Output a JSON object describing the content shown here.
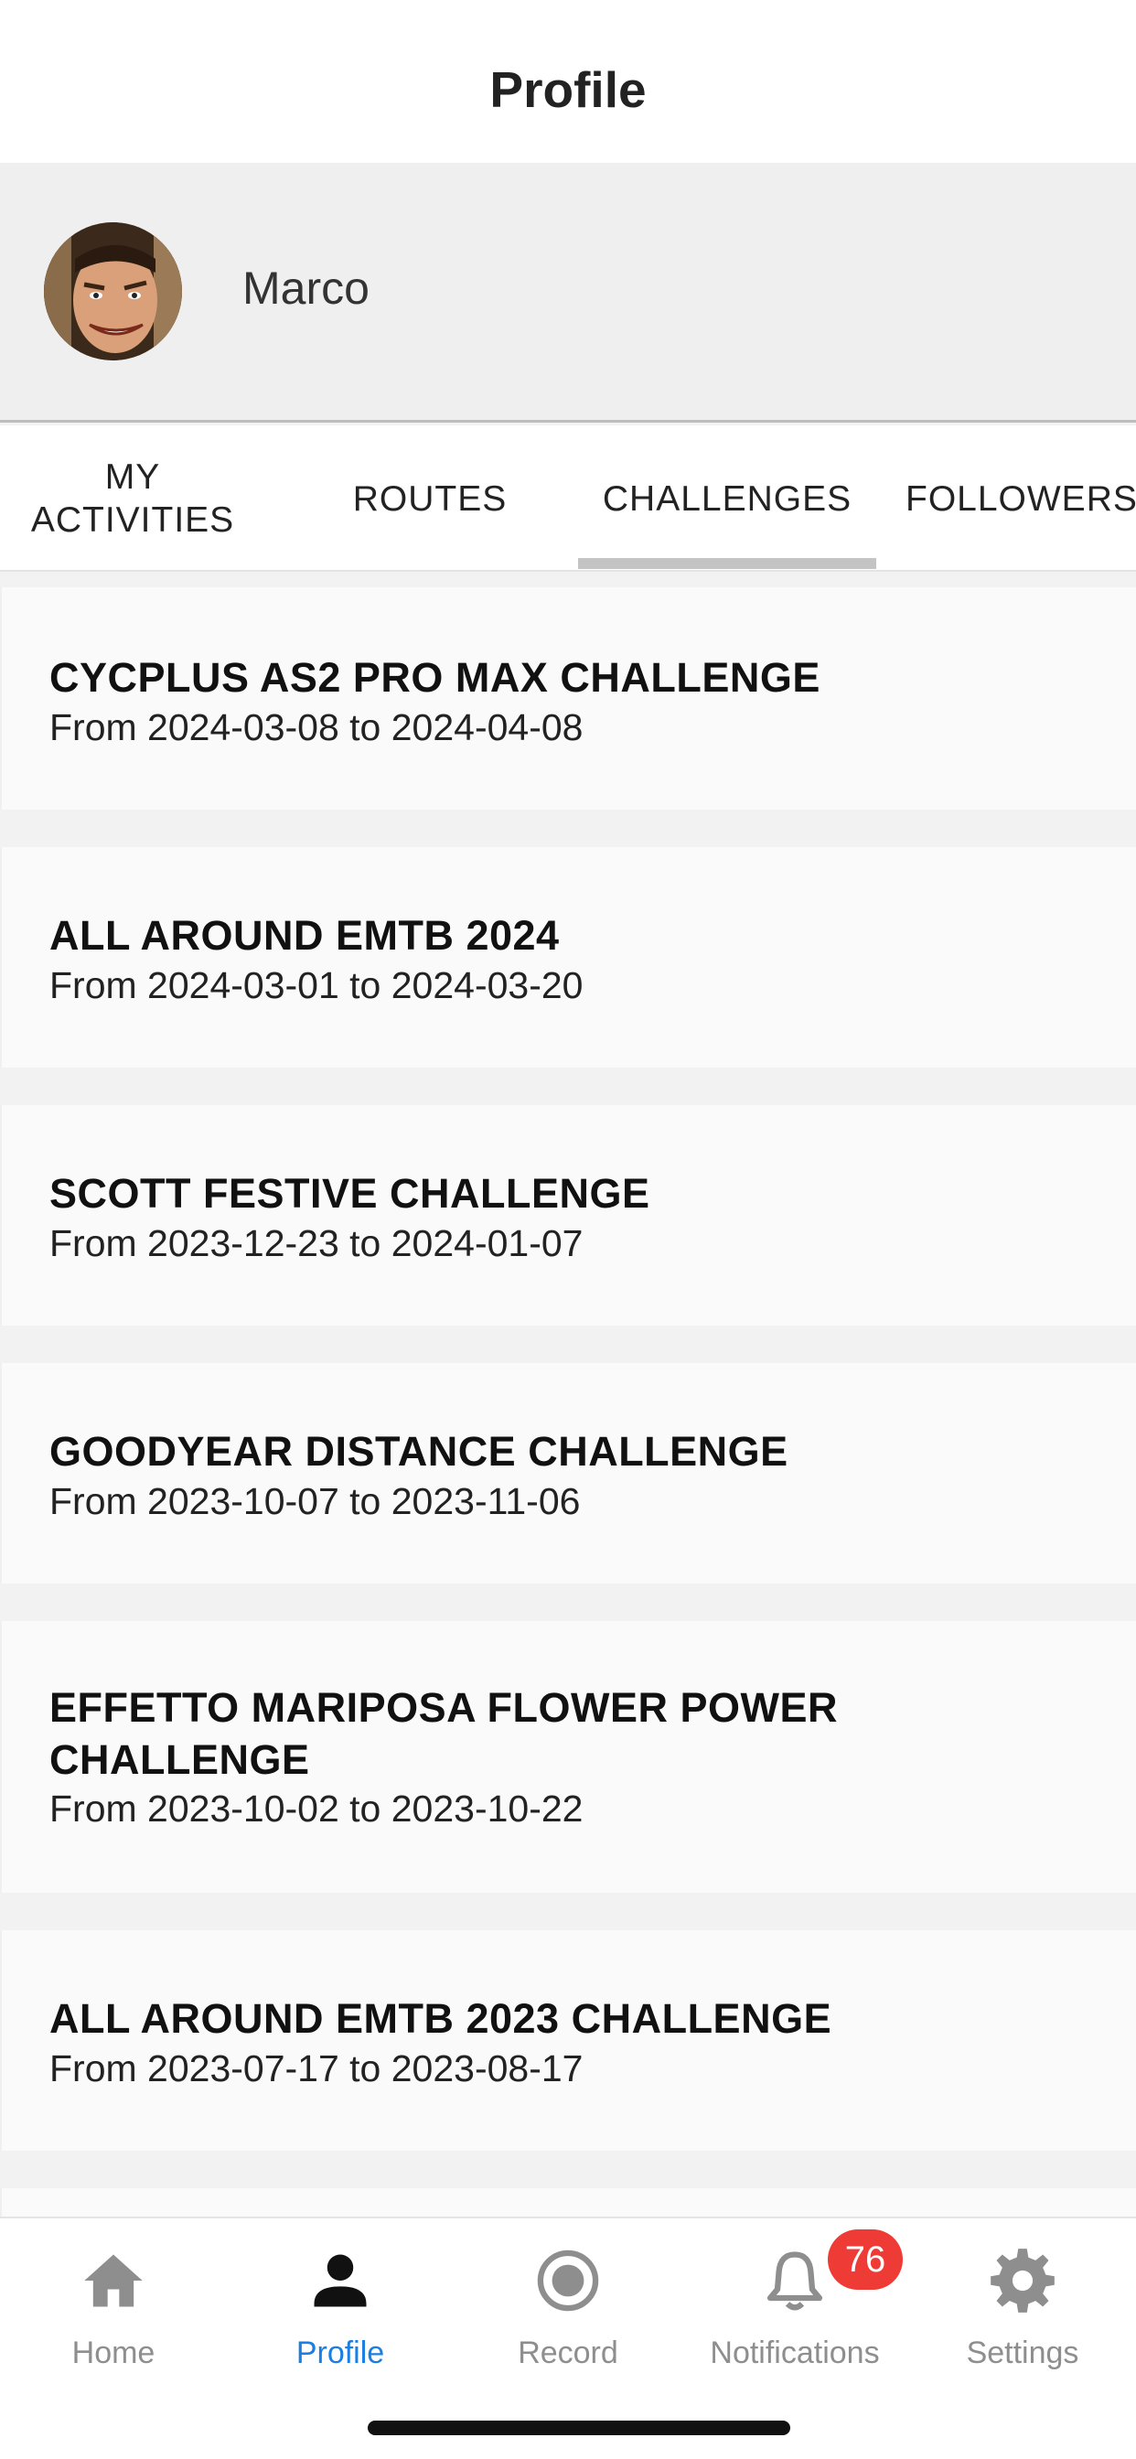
{
  "header": {
    "title": "Profile"
  },
  "profile": {
    "name": "Marco"
  },
  "tabs": [
    {
      "label": "MY ACTIVITIES",
      "line1": "MY",
      "line2": "ACTIVITIES",
      "active": false
    },
    {
      "label": "ROUTES",
      "active": false
    },
    {
      "label": "CHALLENGES",
      "active": true
    },
    {
      "label": "FOLLOWERS",
      "active": false
    }
  ],
  "challenges": [
    {
      "title": "CYCPLUS AS2 PRO MAX CHALLENGE",
      "dates": "From 2024-03-08 to 2024-04-08"
    },
    {
      "title": "ALL AROUND EMTB 2024",
      "dates": "From 2024-03-01 to 2024-03-20"
    },
    {
      "title": "SCOTT FESTIVE CHALLENGE",
      "dates": "From 2023-12-23 to 2024-01-07"
    },
    {
      "title": "GOODYEAR DISTANCE CHALLENGE",
      "dates": "From 2023-10-07 to 2023-11-06"
    },
    {
      "title": "EFFETTO MARIPOSA FLOWER POWER CHALLENGE",
      "dates": "From 2023-10-02 to 2023-10-22"
    },
    {
      "title": "ALL AROUND EMTB 2023 CHALLENGE",
      "dates": "From 2023-07-17 to 2023-08-17"
    }
  ],
  "bottom_nav": {
    "items": [
      {
        "label": "Home",
        "icon": "home-icon",
        "active": false
      },
      {
        "label": "Profile",
        "icon": "person-icon",
        "active": true
      },
      {
        "label": "Record",
        "icon": "record-icon",
        "active": false
      },
      {
        "label": "Notifications",
        "icon": "bell-icon",
        "active": false
      },
      {
        "label": "Settings",
        "icon": "gear-icon",
        "active": false
      }
    ],
    "notifications_badge": "76"
  },
  "colors": {
    "accent": "#1a7fe0",
    "badge": "#ee3b36",
    "inactive_nav": "#8e8e8e",
    "tab_indicator": "#c4c4c4"
  }
}
